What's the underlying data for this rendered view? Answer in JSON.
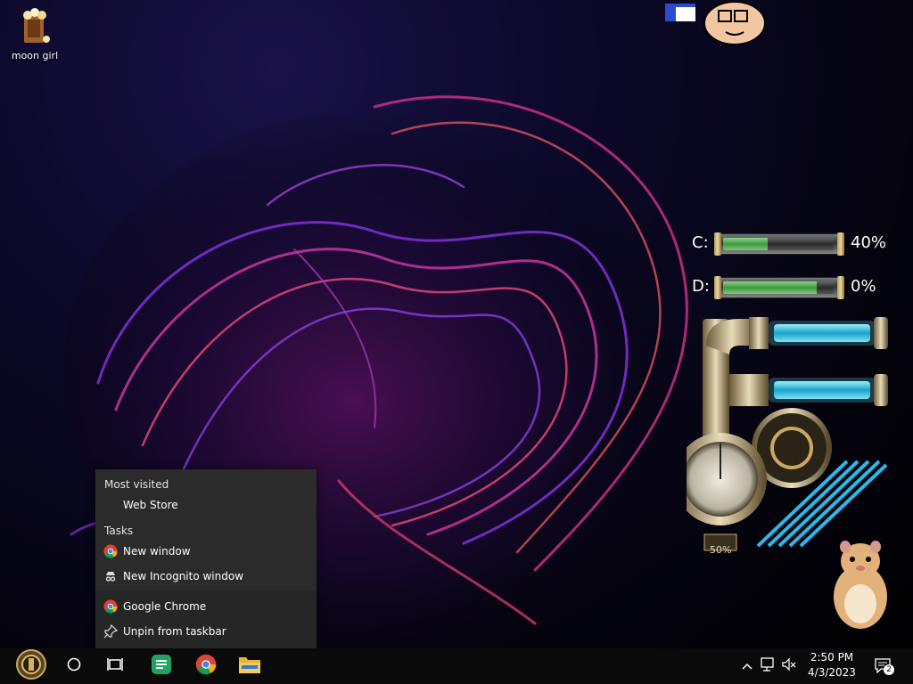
{
  "desktop": {
    "icons": [
      {
        "label": "moon girl",
        "icon": "popcorn-bag-icon"
      }
    ]
  },
  "widgets": {
    "drives": [
      {
        "letter": "C:",
        "percent_text": "40%",
        "fill": 0.4
      },
      {
        "letter": "D:",
        "percent_text": "0%",
        "fill": 0.85
      }
    ],
    "gauge_percent_text": "50%"
  },
  "jumplist": {
    "most_visited_header": "Most visited",
    "most_visited": [
      {
        "label": "Web Store"
      }
    ],
    "tasks_header": "Tasks",
    "tasks": [
      {
        "label": "New window",
        "icon": "chrome-icon"
      },
      {
        "label": "New Incognito window",
        "icon": "incognito-icon"
      }
    ],
    "app_label": "Google Chrome",
    "unpin_label": "Unpin from taskbar"
  },
  "taskbar": {
    "pinned": [
      {
        "name": "start",
        "icon": "steampunk-start-icon"
      },
      {
        "name": "cortana",
        "icon": "cortana-circle-icon"
      },
      {
        "name": "task-view",
        "icon": "task-view-icon"
      },
      {
        "name": "sheets",
        "icon": "green-sheets-icon"
      },
      {
        "name": "chrome",
        "icon": "chrome-icon"
      },
      {
        "name": "file-explorer",
        "icon": "folder-icon"
      }
    ],
    "clock_time": "2:50 PM",
    "clock_date": "4/3/2023",
    "notification_count": "2"
  },
  "colors": {
    "taskbar_bg": "#0a0a0a",
    "jumplist_bg": "#2b2b2b",
    "drive_fill": "#3c9a3c",
    "accent_magenta": "#c0339a"
  }
}
